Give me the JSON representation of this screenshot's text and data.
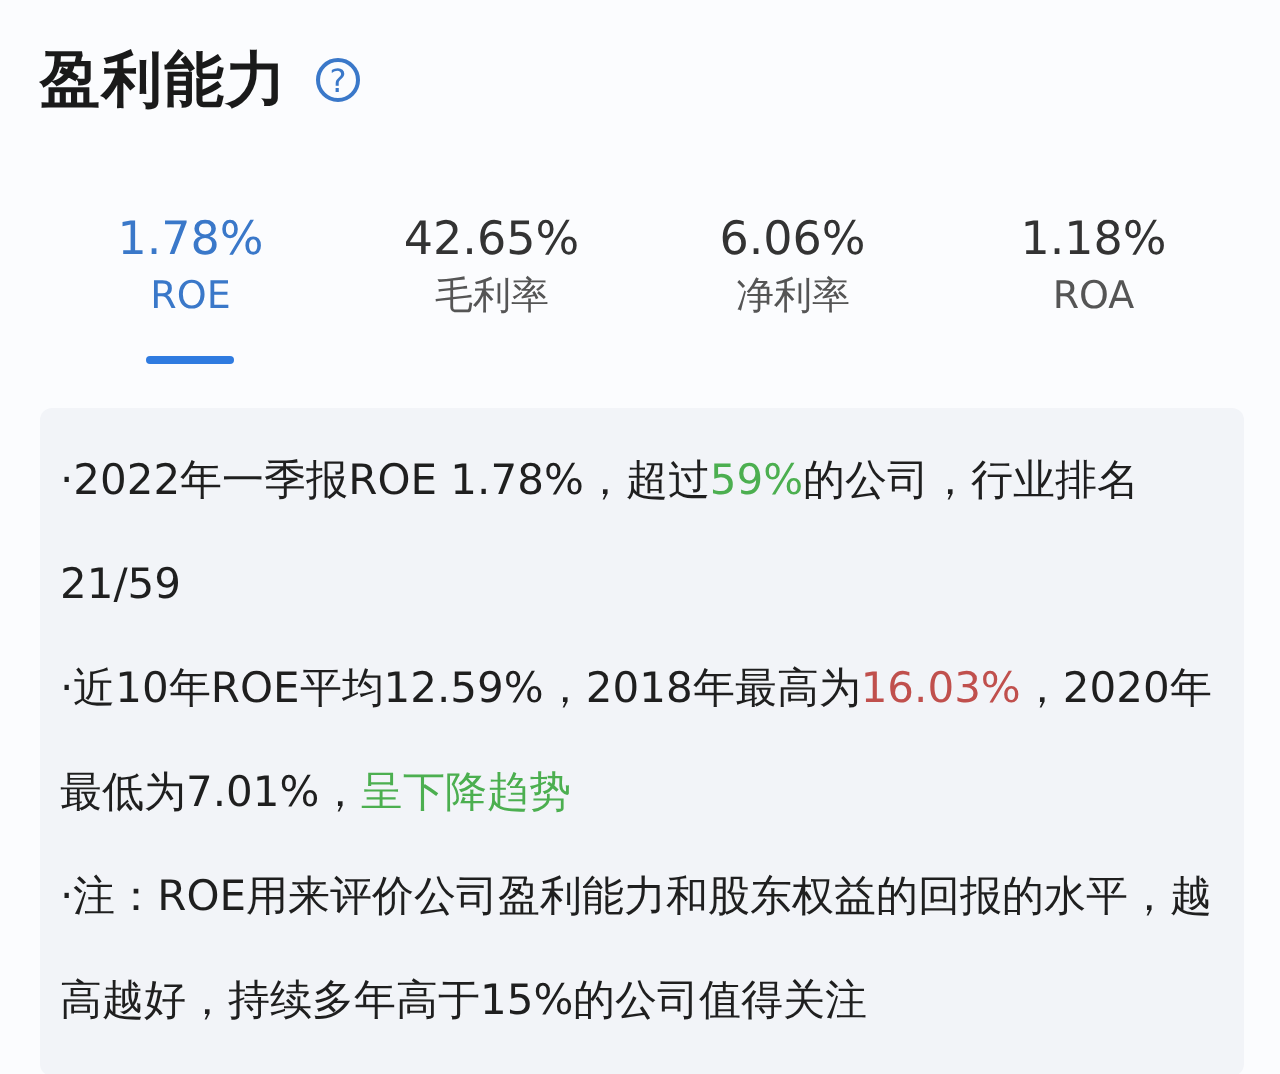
{
  "title": "盈利能力",
  "help_icon_text": "?",
  "tabs": [
    {
      "value": "1.78%",
      "label": "ROE",
      "selected": true
    },
    {
      "value": "42.65%",
      "label": "毛利率",
      "selected": false
    },
    {
      "value": "6.06%",
      "label": "净利率",
      "selected": false
    },
    {
      "value": "1.18%",
      "label": "ROA",
      "selected": false
    }
  ],
  "notes": [
    {
      "segments": [
        {
          "text": "·2022年一季报ROE 1.78%，超过"
        },
        {
          "text": "59%",
          "color": "#4caf50"
        },
        {
          "text": "的公司，行业排名21/59"
        }
      ]
    },
    {
      "segments": [
        {
          "text": "·近10年ROE平均12.59%，2018年最高为"
        },
        {
          "text": "16.03%",
          "color": "#c0504d"
        },
        {
          "text": "，2020年最低为7.01%，"
        },
        {
          "text": "呈下降趋势",
          "color": "#4caf50"
        }
      ]
    },
    {
      "segments": [
        {
          "text": "·注：ROE用来评价公司盈利能力和股东权益的回报的水平，越高越好，持续多年高于15%的公司值得关注"
        }
      ]
    }
  ]
}
